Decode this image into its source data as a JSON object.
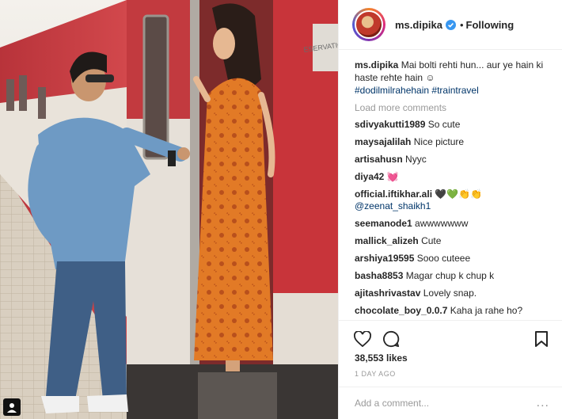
{
  "post": {
    "owner": "ms.dipika",
    "separator": "•",
    "follow_status": "Following",
    "caption_text": "Mai bolti rehti hun... aur ye hain ki haste rehte hain ☺",
    "hashtags": "#dodilmilrahehain #traintravel",
    "load_more": "Load more comments",
    "likes": "38,553 likes",
    "time_ago": "1 DAY AGO",
    "add_comment_placeholder": "Add a comment...",
    "more_label": "..."
  },
  "photo": {
    "door_sign": "ESERVATION"
  },
  "comments": [
    {
      "user": "sdivyakutti1989",
      "text": "So cute"
    },
    {
      "user": "maysajalilah",
      "text": "Nice picture"
    },
    {
      "user": "artisahusn",
      "text": "Nyyc"
    },
    {
      "user": "diya42",
      "text": "💓"
    },
    {
      "user": "official.iftikhar.ali",
      "text": "🖤💚👏👏",
      "mention": "@zeenat_shaikh1"
    },
    {
      "user": "seemanode1",
      "text": "awwwwwww"
    },
    {
      "user": "mallick_alizeh",
      "text": "Cute"
    },
    {
      "user": "arshiya19595",
      "text": "Sooo cuteee"
    },
    {
      "user": "basha8853",
      "text": "Magar chup k chup k"
    },
    {
      "user": "ajitashrivastav",
      "text": "Lovely snap."
    },
    {
      "user": "chocolate_boy_0.0.7",
      "text": "Kaha ja rahe ho?"
    }
  ],
  "icons": {
    "like": "heart-icon",
    "comment": "comment-bubble-icon",
    "save": "bookmark-icon",
    "verified": "verified-badge-icon"
  },
  "colors": {
    "link": "#003569",
    "verified": "#3897f0",
    "train_red": "#c8343a",
    "dress_orange": "#e07a2a"
  }
}
